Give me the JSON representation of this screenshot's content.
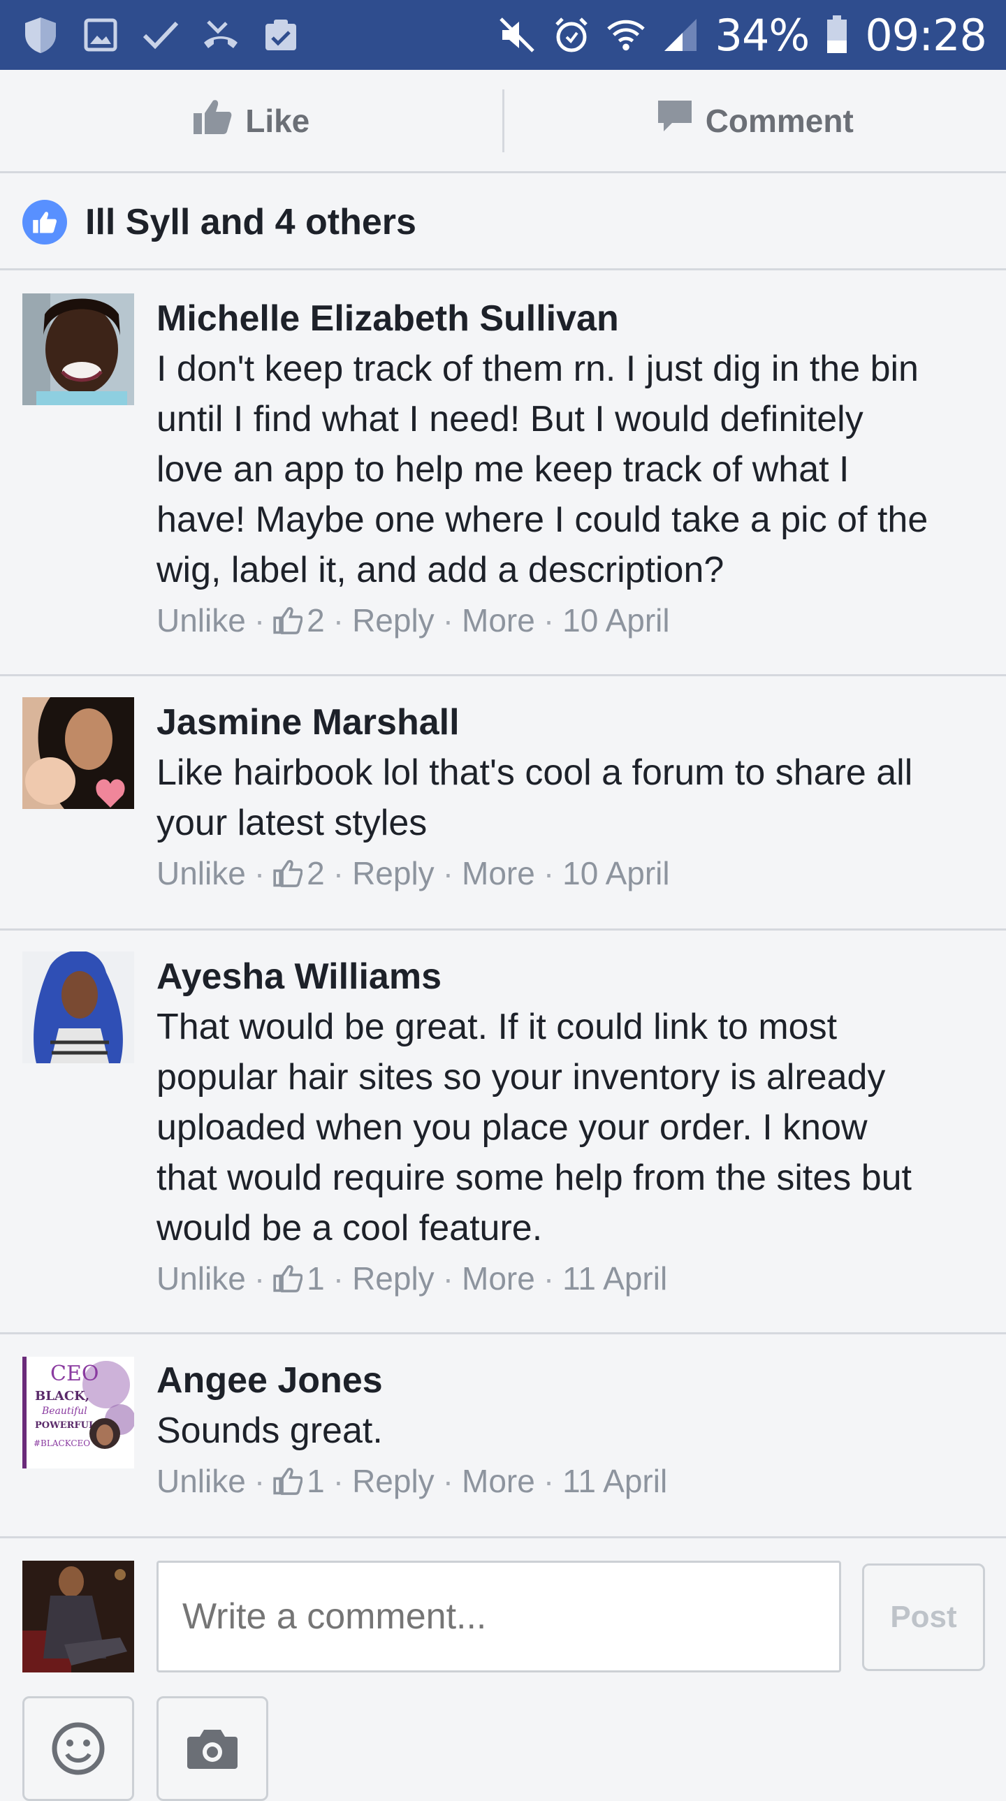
{
  "status_bar": {
    "battery": "34%",
    "time": "09:28",
    "left_icons": [
      "shield-icon",
      "gallery-icon",
      "check-icon",
      "missed-call-icon",
      "clipboard-icon"
    ],
    "right_icons": [
      "mute-icon",
      "alarm-icon",
      "wifi-icon",
      "signal-icon",
      "battery-icon"
    ]
  },
  "actions": {
    "like_label": "Like",
    "comment_label": "Comment"
  },
  "likes_summary": "Ill Syll and 4 others",
  "comments": [
    {
      "name": "Michelle Elizabeth Sullivan",
      "lines": [
        "I don't keep track of them rn. I just dig in the bin",
        "until I find what I need! But I would definitely",
        "love an app to help me keep track of what I",
        "have! Maybe one where I could take a pic of the",
        "wig, label it, and add a description?"
      ],
      "unlike": "Unlike",
      "likes": "2",
      "reply": "Reply",
      "more": "More",
      "date": "10 April"
    },
    {
      "name": "Jasmine Marshall",
      "lines": [
        "Like hairbook lol that's cool a forum to share all",
        "your latest styles"
      ],
      "unlike": "Unlike",
      "likes": "2",
      "reply": "Reply",
      "more": "More",
      "date": "10 April"
    },
    {
      "name": "Ayesha Williams",
      "lines": [
        "That would be great. If it could link to most",
        "popular hair sites so your inventory is already",
        "uploaded when you place your order. I know",
        "that would require some help from the sites but",
        "would be a cool feature."
      ],
      "unlike": "Unlike",
      "likes": "1",
      "reply": "Reply",
      "more": "More",
      "date": "11 April"
    },
    {
      "name": "Angee Jones",
      "lines": [
        "Sounds great."
      ],
      "unlike": "Unlike",
      "likes": "1",
      "reply": "Reply",
      "more": "More",
      "date": "11 April"
    }
  ],
  "composer": {
    "placeholder": "Write a comment...",
    "post_label": "Post"
  },
  "avatar_badge": {
    "ceo": "CEO",
    "line1": "BLACK,",
    "line2": "Beautiful",
    "line3": "POWERFUL",
    "line4": "#BLACKCEO"
  },
  "colors": {
    "status_bar": "#2f4d8e",
    "like_blue": "#5890ff",
    "meta_gray": "#8d949e",
    "text": "#1d2129"
  }
}
